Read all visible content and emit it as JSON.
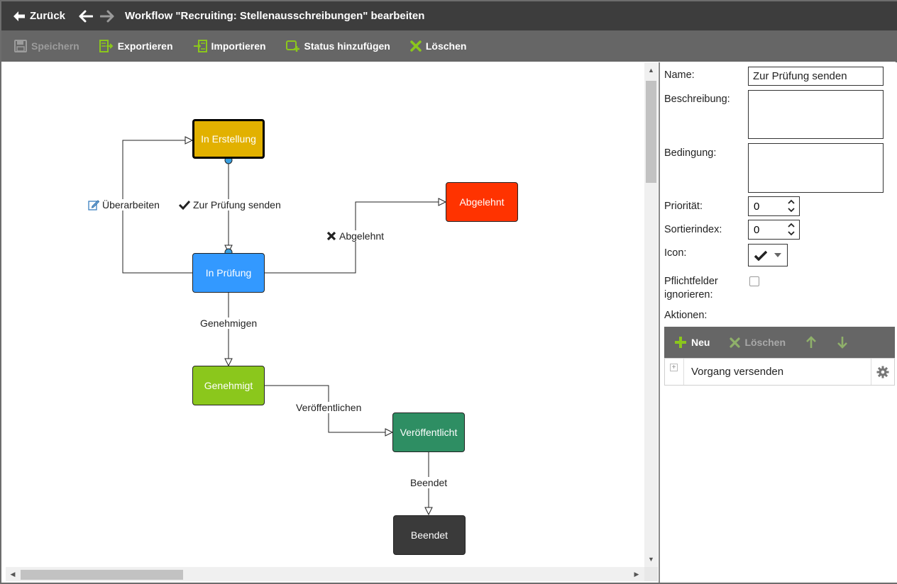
{
  "titlebar": {
    "back_label": "Zurück",
    "title": "Workflow \"Recruiting: Stellenausschreibungen\" bearbeiten"
  },
  "toolbar": {
    "save_label": "Speichern",
    "export_label": "Exportieren",
    "import_label": "Importieren",
    "add_status_label": "Status hinzufügen",
    "delete_label": "Löschen"
  },
  "workflow": {
    "nodes": {
      "in_erstellung": "In Erstellung",
      "in_pruefung": "In Prüfung",
      "abgelehnt": "Abgelehnt",
      "genehmigt": "Genehmigt",
      "veroeffentlicht": "Veröffentlicht",
      "beendet": "Beendet"
    },
    "transitions": {
      "ueberarbeiten": "Überarbeiten",
      "zur_pruefung_senden": "Zur Prüfung senden",
      "abgelehnt": "Abgelehnt",
      "genehmigen": "Genehmigen",
      "veroeffentlichen": "Veröffentlichen",
      "beendet": "Beendet"
    },
    "colors": {
      "in_erstellung": "#E2B100",
      "in_pruefung": "#3399FF",
      "abgelehnt": "#FF3300",
      "genehmigt": "#8BC71C",
      "veroeffentlicht": "#2E8E63",
      "beendet": "#3A3A3A"
    }
  },
  "properties": {
    "name_label": "Name:",
    "name_value": "Zur Prüfung senden",
    "description_label": "Beschreibung:",
    "description_value": "",
    "condition_label": "Bedingung:",
    "condition_value": "",
    "priority_label": "Priorität:",
    "priority_value": "0",
    "sortindex_label": "Sortierindex:",
    "sortindex_value": "0",
    "icon_label": "Icon:",
    "icon_value": "check-icon",
    "mandatory_label_1": "Pflichtfelder",
    "mandatory_label_2": "ignorieren:",
    "mandatory_checked": false,
    "actions_label": "Aktionen:",
    "actions_toolbar": {
      "new_label": "Neu",
      "delete_label": "Löschen"
    },
    "actions": [
      {
        "label": "Vorgang versenden"
      }
    ]
  }
}
